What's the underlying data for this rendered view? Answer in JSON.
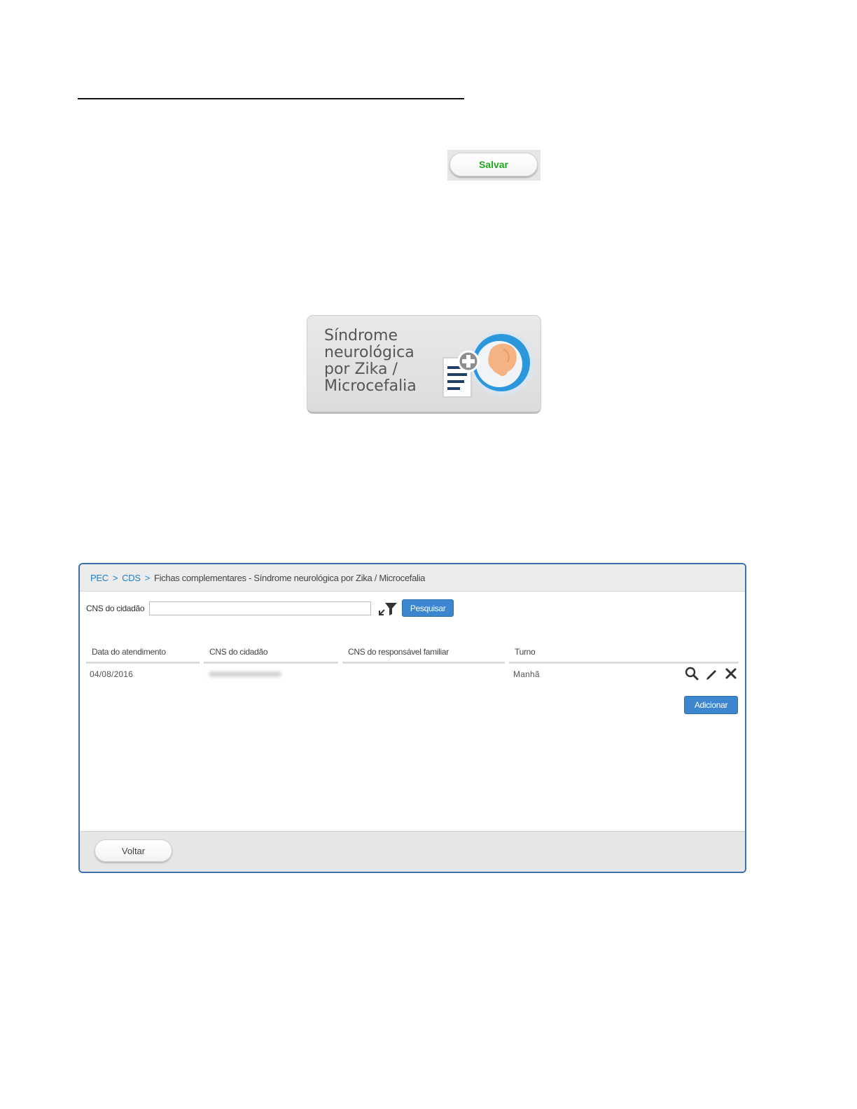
{
  "salvar_snippet": {
    "button_label": "Salvar"
  },
  "tile": {
    "title_lines": [
      "Síndrome",
      "neurológica",
      "por Zika /",
      "Microcefalia"
    ],
    "icon": "zika-microcefalia-record-icon"
  },
  "app": {
    "breadcrumb": {
      "links": [
        "PEC",
        "CDS"
      ],
      "separator": ">",
      "current": "Fichas complementares - Síndrome neurológica por Zika / Microcefalia"
    },
    "search": {
      "label": "CNS do cidadão",
      "value": "",
      "filter_icon": "filter-icon",
      "button_label": "Pesquisar"
    },
    "table": {
      "columns": [
        "Data do atendimento",
        "CNS do cidadão",
        "CNS do responsável familiar",
        "Turno"
      ],
      "rows": [
        {
          "data_atendimento": "04/08/2016",
          "cns_cidadao": "",
          "cns_responsavel": "",
          "turno": "Manhã",
          "actions": [
            "search-icon",
            "edit-icon",
            "delete-icon"
          ]
        }
      ]
    },
    "add_button_label": "Adicionar",
    "footer": {
      "back_button_label": "Voltar"
    },
    "colors": {
      "accent_blue": "#3b86cf",
      "link_blue": "#1e7fd6",
      "save_green": "#1fa81f"
    }
  }
}
